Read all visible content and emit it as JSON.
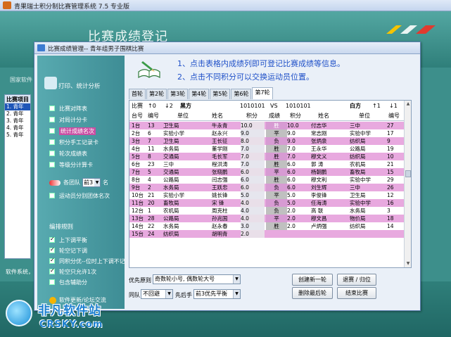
{
  "app": {
    "title": "青果瑞士积分制比赛管理系统 7.5 专业版",
    "banner_title": "比赛成绩登记",
    "side_label": "国家软件",
    "status_text": "软件系统，",
    "left_list": {
      "header": "比赛项目",
      "items": [
        "1. 青年",
        "2. 青年",
        "3. 青年",
        "4. 青年",
        "5. 青年"
      ]
    }
  },
  "watermark": {
    "cn": "非凡软件站",
    "en": "CRSKY.com"
  },
  "dialog": {
    "title": "比赛成绩管理-- 青年组男子围棋比赛",
    "sidebar": {
      "heading": "打印、统计分析",
      "items": [
        {
          "label": "比赛对阵表",
          "checked": false,
          "highlight": false
        },
        {
          "label": "对局计分卡",
          "checked": false,
          "highlight": false
        },
        {
          "label": "统计成绩名次",
          "checked": false,
          "highlight": true
        },
        {
          "label": "积分手工记录卡",
          "checked": false,
          "highlight": false
        },
        {
          "label": "轮次成绩表",
          "checked": false,
          "highlight": false
        },
        {
          "label": "等级分计算卡",
          "checked": false,
          "highlight": false
        }
      ],
      "group_prefix": "各团队",
      "group_select": "前3",
      "group_suffix": "名",
      "team_item": "运动员分别团体名次",
      "rules_heading": "编排规则",
      "rules": [
        {
          "label": "上下调平衡",
          "checked": true
        },
        {
          "label": "轮空记下调",
          "checked": true
        },
        {
          "label": "同积分优--位时上下调不记",
          "checked": true
        },
        {
          "label": "轮空只允许1次",
          "checked": true
        },
        {
          "label": "包含辅助分",
          "checked": false
        }
      ],
      "update_link": "软件更新/论坛交流"
    },
    "hints": [
      "1、点击表格内成绩列即可登记比赛成绩等信息。",
      "2、点击不同积分可以交换运动员位置。"
    ],
    "tabs": [
      "首轮",
      "第2轮",
      "第3轮",
      "第4轮",
      "第5轮",
      "第6轮",
      "第7轮"
    ],
    "active_tab": 6,
    "panel": {
      "header1": {
        "race": "比赛",
        "up": "↑0",
        "down": "↓2",
        "left_side": "黑方",
        "left_code": "1010101",
        "vs": "VS",
        "right_code": "1010101",
        "right_side": "白方",
        "r_up": "↑1",
        "r_down": "↓1"
      },
      "header2": {
        "table": "台号",
        "num_l": "编号",
        "unit_l": "单位",
        "name_l": "姓名",
        "score_l": "积分",
        "result": "成绩",
        "score_r": "积分",
        "name_r": "姓名",
        "unit_r": "单位",
        "num_r": "编号"
      },
      "rows": [
        {
          "t": "1台",
          "n": "13",
          "u": "卫生局",
          "nm": "牛永青",
          "s": "10.0",
          "r": "胜",
          "rs": "10.0",
          "rn": "付志华",
          "ru": "三中",
          "rnum": "27",
          "c": "pink"
        },
        {
          "t": "2台",
          "n": "6",
          "u": "实验小学",
          "nm": "赵永兴",
          "s": "9.0",
          "r": "平",
          "rs": "9.0",
          "rn": "常志刚",
          "ru": "实验中学",
          "rnum": "17",
          "c": "white"
        },
        {
          "t": "3台",
          "n": "7",
          "u": "卫生局",
          "nm": "王长征",
          "s": "8.0",
          "r": "负",
          "rs": "9.0",
          "rn": "张炳泉",
          "ru": "纺织局",
          "rnum": "9",
          "c": "pink"
        },
        {
          "t": "4台",
          "n": "11",
          "u": "水务局",
          "nm": "董学刚",
          "s": "7.0",
          "r": "胜",
          "rs": "7.0",
          "rn": "王永华",
          "ru": "公路局",
          "rnum": "19",
          "c": "white"
        },
        {
          "t": "5台",
          "n": "8",
          "u": "交通局",
          "nm": "毛长军",
          "s": "7.0",
          "r": "胜",
          "rs": "7.0",
          "rn": "穆文义",
          "ru": "纺织局",
          "rnum": "10",
          "c": "pink"
        },
        {
          "t": "6台",
          "n": "23",
          "u": "三中",
          "nm": "程洪涛",
          "s": "7.0",
          "r": "胜",
          "rs": "6.0",
          "rn": "郭  涛",
          "ru": "农机局",
          "rnum": "21",
          "c": "white"
        },
        {
          "t": "7台",
          "n": "5",
          "u": "交通局",
          "nm": "张晓鹏",
          "s": "6.0",
          "r": "平",
          "rs": "6.0",
          "rn": "杨朝鹏",
          "ru": "畜牧局",
          "rnum": "15",
          "c": "pink"
        },
        {
          "t": "8台",
          "n": "4",
          "u": "公路局",
          "nm": "闫志强",
          "s": "6.0",
          "r": "胜",
          "rs": "6.0",
          "rn": "穆文利",
          "ru": "实验中学",
          "rnum": "29",
          "c": "white"
        },
        {
          "t": "9台",
          "n": "2",
          "u": "水务局",
          "nm": "王跃忠",
          "s": "6.0",
          "r": "负",
          "rs": "6.0",
          "rn": "刘生辉",
          "ru": "三中",
          "rnum": "26",
          "c": "pink"
        },
        {
          "t": "10台",
          "n": "21",
          "u": "实验小学",
          "nm": "姚长锋",
          "s": "5.0",
          "r": "平",
          "rs": "5.0",
          "rn": "李俊锋",
          "ru": "卫生局",
          "rnum": "12",
          "c": "white"
        },
        {
          "t": "11台",
          "n": "20",
          "u": "畜牧局",
          "nm": "宋  锋",
          "s": "4.0",
          "r": "负",
          "rs": "5.0",
          "rn": "任海涛",
          "ru": "实验中学",
          "rnum": "16",
          "c": "pink"
        },
        {
          "t": "12台",
          "n": "1",
          "u": "农机局",
          "nm": "周克柱",
          "s": "4.0",
          "r": "负",
          "rs": "2.0",
          "rn": "高  联",
          "ru": "水务局",
          "rnum": "3",
          "c": "white"
        },
        {
          "t": "13台",
          "n": "28",
          "u": "公路局",
          "nm": "孙兆国",
          "s": "4.0",
          "r": "平",
          "rs": "2.0",
          "rn": "穆文昌",
          "ru": "物价局",
          "rnum": "18",
          "c": "pink"
        },
        {
          "t": "14台",
          "n": "22",
          "u": "水务局",
          "nm": "赵永春",
          "s": "3.0",
          "r": "胜",
          "rs": "2.0",
          "rn": "卢炳强",
          "ru": "纺织局",
          "rnum": "14",
          "c": "white"
        },
        {
          "t": "15台",
          "n": "24",
          "u": "纺织局",
          "nm": "胡明青",
          "s": "2.0",
          "r": "",
          "rs": "",
          "rn": "",
          "ru": "",
          "rnum": "",
          "c": "pink"
        }
      ]
    },
    "controls": {
      "priority_label": "优先原则",
      "priority_value": "奇数轮小号, 偶数轮大号",
      "same_unit_label": "同队",
      "same_unit_value": "不回避",
      "first_hand_label": "先后手",
      "first_hand_value": "前3优先平衡",
      "btn_create": "创建新一轮",
      "btn_withdraw": "退赛 / 归位",
      "btn_delete": "删除最后轮",
      "btn_end": "结束比赛"
    }
  }
}
